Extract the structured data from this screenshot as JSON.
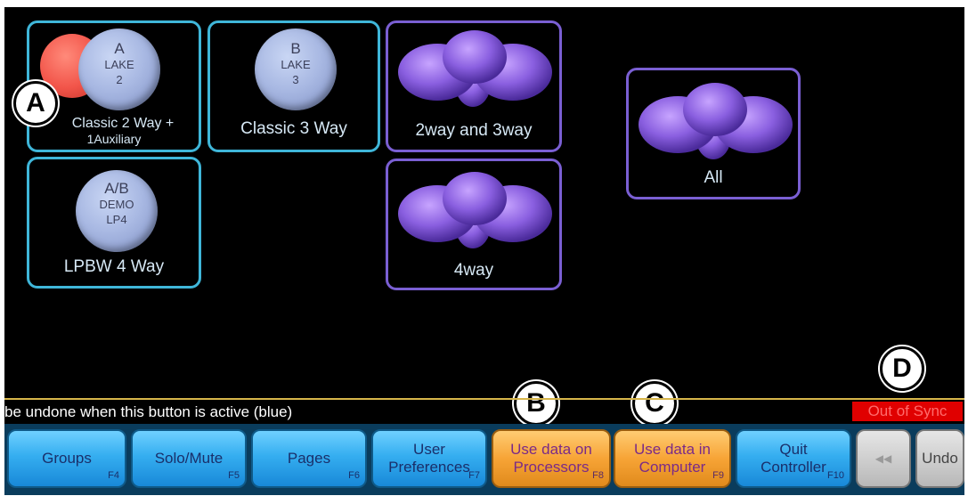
{
  "tiles": [
    {
      "label_top": "Classic 2 Way +",
      "label_bottom": "1Auxiliary",
      "disc": {
        "letter": "A",
        "line2": "LAKE",
        "line3": "2"
      }
    },
    {
      "label": "Classic 3 Way",
      "disc": {
        "letter": "B",
        "line2": "LAKE",
        "line3": "3"
      }
    },
    {
      "label": "2way and 3way"
    },
    {
      "label": "All"
    },
    {
      "label": "LPBW 4 Way",
      "disc": {
        "letter": "A/B",
        "line2": "DEMO",
        "line3": "LP4"
      }
    },
    {
      "label": "4way"
    }
  ],
  "markers": {
    "a": "A",
    "b": "B",
    "c": "C",
    "d": "D"
  },
  "status": {
    "message": "be undone when this button is active (blue)",
    "sync": "Out of Sync"
  },
  "toolbar": {
    "groups": {
      "label": "Groups",
      "fkey": "F4"
    },
    "solo_mute": {
      "label": "Solo/Mute",
      "fkey": "F5"
    },
    "pages": {
      "label": "Pages",
      "fkey": "F6"
    },
    "user_prefs": {
      "line1": "User",
      "line2": "Preferences",
      "fkey": "F7"
    },
    "use_processors": {
      "line1": "Use data on",
      "line2": "Processors",
      "fkey": "F8"
    },
    "use_computer": {
      "line1": "Use data in",
      "line2": "Computer",
      "fkey": "F9"
    },
    "quit": {
      "line1": "Quit",
      "line2": "Controller",
      "fkey": "F10"
    },
    "rewind_icon": "◀◀",
    "undo": "Undo"
  },
  "colors": {
    "module_border": "#3fb6d9",
    "group_border": "#7a5fd3",
    "toolbar_blue": "#35aef0",
    "toolbar_orange": "#f7a436",
    "sync_red": "#e00000"
  }
}
